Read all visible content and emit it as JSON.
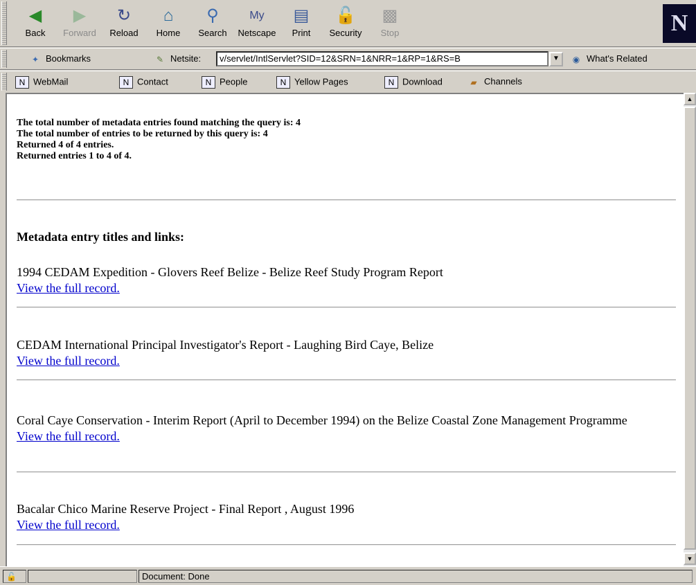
{
  "nav_toolbar": {
    "buttons": [
      {
        "label": "Back",
        "icon": "back-icon",
        "enabled": true
      },
      {
        "label": "Forward",
        "icon": "forward-icon",
        "enabled": false
      },
      {
        "label": "Reload",
        "icon": "reload-icon",
        "enabled": true
      },
      {
        "label": "Home",
        "icon": "home-icon",
        "enabled": true
      },
      {
        "label": "Search",
        "icon": "search-icon",
        "enabled": true
      },
      {
        "label": "Netscape",
        "icon": "my-netscape-icon",
        "enabled": true
      },
      {
        "label": "Print",
        "icon": "print-icon",
        "enabled": true
      },
      {
        "label": "Security",
        "icon": "security-lock-icon",
        "enabled": true
      },
      {
        "label": "Stop",
        "icon": "stop-icon",
        "enabled": false
      }
    ],
    "logo": "N"
  },
  "location_toolbar": {
    "bookmarks_label": "Bookmarks",
    "netsite_label": "Netsite:",
    "url": "v/servlet/IntlServlet?SID=12&SRN=1&NRR=1&RP=1&RS=B",
    "whats_related_label": "What's Related"
  },
  "personal_toolbar": {
    "items": [
      "WebMail",
      "Contact",
      "People",
      "Yellow Pages",
      "Download",
      "Channels"
    ]
  },
  "content": {
    "summary": [
      "The total number of metadata entries found matching the query is: 4",
      "The total number of entries to be returned by this query is: 4",
      "Returned 4 of 4 entries.",
      "Returned entries 1 to 4 of 4."
    ],
    "heading": "Metadata entry titles and links:",
    "link_text": "View the full record.",
    "entries": [
      {
        "title": "1994 CEDAM Expedition - Glovers Reef Belize - Belize Reef Study Program Report"
      },
      {
        "title": "CEDAM International Principal Investigator's Report - Laughing Bird Caye, Belize"
      },
      {
        "title": "Coral Caye Conservation - Interim Report (April to December 1994) on the Belize Coastal Zone Management Programme"
      },
      {
        "title": "Bacalar Chico Marine Reserve Project - Final Report , August 1996"
      }
    ]
  },
  "status_bar": {
    "text": "Document: Done"
  },
  "colors": {
    "link": "#0000cc",
    "chrome": "#d4d0c8"
  }
}
